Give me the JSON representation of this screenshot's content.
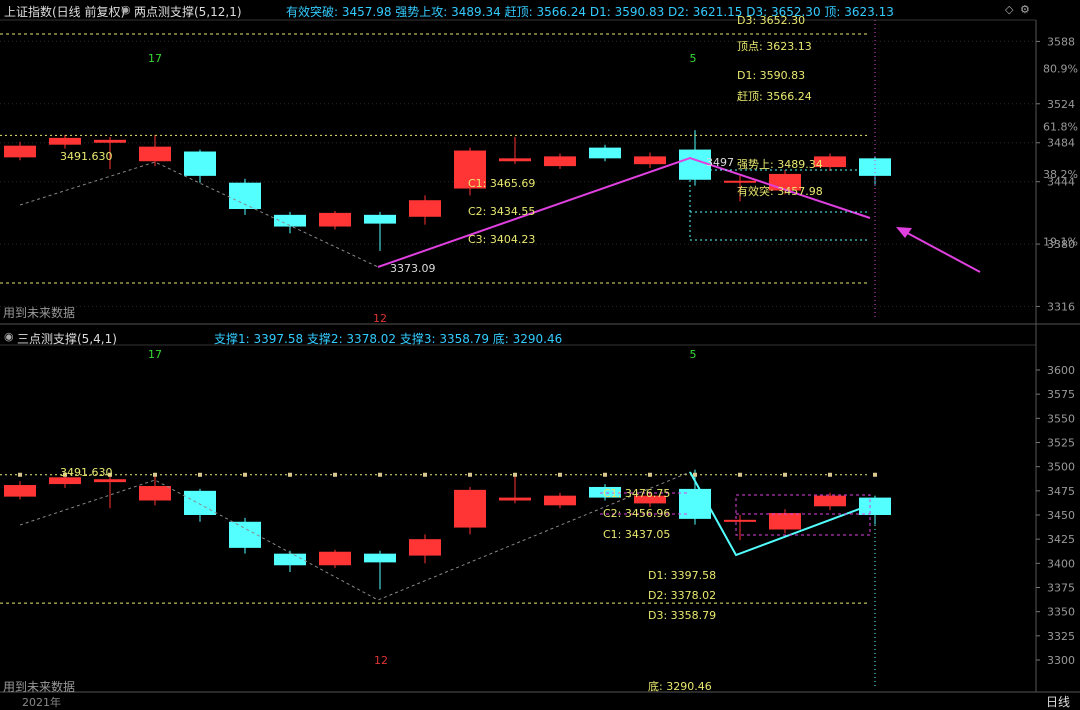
{
  "colors": {
    "up": "#ff3535",
    "down": "#54ffff",
    "accent": "#e040e0",
    "level": "#e8e870",
    "cyan_text": "#33ccff",
    "grid": "#2a2a2a"
  },
  "top_panel": {
    "title": "上证指数(日线 前复权)",
    "indicator": "两点测支撑(5,12,1)",
    "values_text": "有效突破: 3457.98 强势上攻: 3489.34 赶顶: 3566.24 D1: 3590.83 D2: 3621.15 D3: 3652.30 顶: 3623.13",
    "footer_note": "用到未来数据",
    "count_left": "17",
    "count_right": "5",
    "count_bottom": "12",
    "price_ticks": [
      "3588",
      "3524",
      "3484",
      "3444",
      "3380",
      "3316"
    ],
    "pct_ticks": [
      "80.9%",
      "61.8%",
      "38.2%",
      "19.1%"
    ],
    "label_high": "3491.630",
    "label_low": "3373.09",
    "label_peak": "3497",
    "c_labels": [
      "C1: 3465.69",
      "C2: 3434.55",
      "C3: 3404.23"
    ],
    "right_labels": [
      "D3: 3652.30",
      "顶点: 3623.13",
      "D1: 3590.83",
      "赶顶: 3566.24",
      "强势上: 3489.34",
      "有效突: 3457.98"
    ]
  },
  "bottom_panel": {
    "indicator": "三点测支撑(5,4,1)",
    "values_text": "支撑1: 3397.58 支撑2: 3378.02 支撑3: 3358.79 底: 3290.46",
    "footer_note": "用到未来数据",
    "count_left": "17",
    "count_right": "5",
    "count_bottom": "12",
    "price_ticks": [
      "3600",
      "3575",
      "3550",
      "3525",
      "3500",
      "3475",
      "3450",
      "3425",
      "3400",
      "3375",
      "3350",
      "3325",
      "3300"
    ],
    "label_high": "3491.630",
    "c_labels": [
      "C1: 3476.75",
      "C2: 3456.96",
      "C1: 3437.05"
    ],
    "d_labels": [
      "D1: 3397.58",
      "D2: 3378.02",
      "D3: 3358.79"
    ],
    "bottom_label": "底: 3290.46"
  },
  "status_bar": {
    "year": "2021年",
    "period": "日线"
  },
  "chart_data": [
    {
      "type": "candlestick",
      "title": "上证指数(日线 前复权)",
      "indicator": "两点测支撑(5,12,1)",
      "candles": [
        {
          "o": 3469,
          "c": 3481,
          "h": 3485,
          "l": 3466
        },
        {
          "o": 3482,
          "c": 3489,
          "h": 3492,
          "l": 3478
        },
        {
          "o": 3484,
          "c": 3487,
          "h": 3490,
          "l": 3457
        },
        {
          "o": 3465,
          "c": 3480,
          "h": 3492,
          "l": 3460
        },
        {
          "o": 3475,
          "c": 3450,
          "h": 3477,
          "l": 3443
        },
        {
          "o": 3443,
          "c": 3416,
          "h": 3447,
          "l": 3410
        },
        {
          "o": 3410,
          "c": 3398,
          "h": 3413,
          "l": 3391
        },
        {
          "o": 3398,
          "c": 3412,
          "h": 3414,
          "l": 3395
        },
        {
          "o": 3410,
          "c": 3401,
          "h": 3413,
          "l": 3373
        },
        {
          "o": 3408,
          "c": 3425,
          "h": 3430,
          "l": 3400
        },
        {
          "o": 3437,
          "c": 3476,
          "h": 3479,
          "l": 3430
        },
        {
          "o": 3465,
          "c": 3468,
          "h": 3490,
          "l": 3462
        },
        {
          "o": 3460,
          "c": 3470,
          "h": 3473,
          "l": 3457
        },
        {
          "o": 3479,
          "c": 3468,
          "h": 3482,
          "l": 3465
        },
        {
          "o": 3462,
          "c": 3470,
          "h": 3474,
          "l": 3458
        },
        {
          "o": 3477,
          "c": 3446,
          "h": 3497,
          "l": 3440
        },
        {
          "o": 3444,
          "c": 3445,
          "h": 3450,
          "l": 3424
        },
        {
          "o": 3435,
          "c": 3452,
          "h": 3456,
          "l": 3431
        },
        {
          "o": 3459,
          "c": 3470,
          "h": 3473,
          "l": 3455
        },
        {
          "o": 3468,
          "c": 3450,
          "h": 3470,
          "l": 3440
        }
      ],
      "levels": {
        "有效突破": 3457.98,
        "强势上攻": 3489.34,
        "赶顶": 3566.24,
        "D1": 3590.83,
        "D2": 3621.15,
        "D3": 3652.3,
        "顶": 3623.13
      },
      "y_ticks": [
        3588,
        3524,
        3484,
        3444,
        3380,
        3316
      ]
    },
    {
      "type": "candlestick",
      "indicator": "三点测支撑(5,4,1)",
      "levels": {
        "支撑1": 3397.58,
        "支撑2": 3378.02,
        "支撑3": 3358.79,
        "底": 3290.46
      },
      "y_ticks": [
        3600,
        3575,
        3550,
        3525,
        3500,
        3475,
        3450,
        3425,
        3400,
        3375,
        3350,
        3325,
        3300
      ]
    }
  ]
}
